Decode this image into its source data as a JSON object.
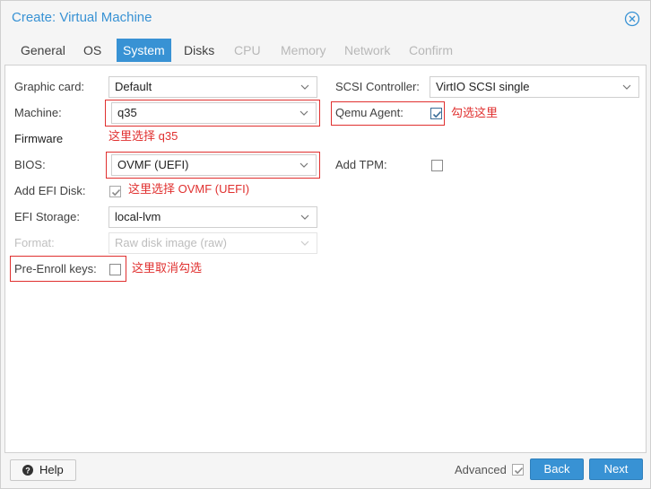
{
  "window": {
    "title": "Create: Virtual Machine"
  },
  "tabs": [
    {
      "label": "General",
      "state": "normal"
    },
    {
      "label": "OS",
      "state": "normal"
    },
    {
      "label": "System",
      "state": "active"
    },
    {
      "label": "Disks",
      "state": "normal"
    },
    {
      "label": "CPU",
      "state": "disabled"
    },
    {
      "label": "Memory",
      "state": "disabled"
    },
    {
      "label": "Network",
      "state": "disabled"
    },
    {
      "label": "Confirm",
      "state": "disabled"
    }
  ],
  "form": {
    "graphic_card": {
      "label": "Graphic card:",
      "value": "Default"
    },
    "scsi_controller": {
      "label": "SCSI Controller:",
      "value": "VirtIO SCSI single"
    },
    "machine": {
      "label": "Machine:",
      "value": "q35"
    },
    "qemu_agent": {
      "label": "Qemu Agent:",
      "checked": true
    },
    "firmware_heading": "Firmware",
    "bios": {
      "label": "BIOS:",
      "value": "OVMF (UEFI)"
    },
    "add_tpm": {
      "label": "Add TPM:",
      "checked": false
    },
    "add_efi_disk": {
      "label": "Add EFI Disk:",
      "checked": true
    },
    "efi_storage": {
      "label": "EFI Storage:",
      "value": "local-lvm"
    },
    "format": {
      "label": "Format:",
      "value": "Raw disk image (raw)",
      "disabled": true
    },
    "pre_enroll_keys": {
      "label": "Pre-Enroll keys:",
      "checked": false
    }
  },
  "annotations": {
    "machine_note": "这里选择 q35",
    "qemu_note": "勾选这里",
    "bios_note": "这里选择 OVMF (UEFI)",
    "prenroll_note": "这里取消勾选",
    "highlight_color": "#e0302f"
  },
  "footer": {
    "help_label": "Help",
    "advanced_label": "Advanced",
    "advanced_checked": true,
    "back_label": "Back",
    "next_label": "Next"
  },
  "colors": {
    "accent": "#3892d4",
    "panel_bg": "#ffffff",
    "window_bg": "#f5f5f5"
  }
}
